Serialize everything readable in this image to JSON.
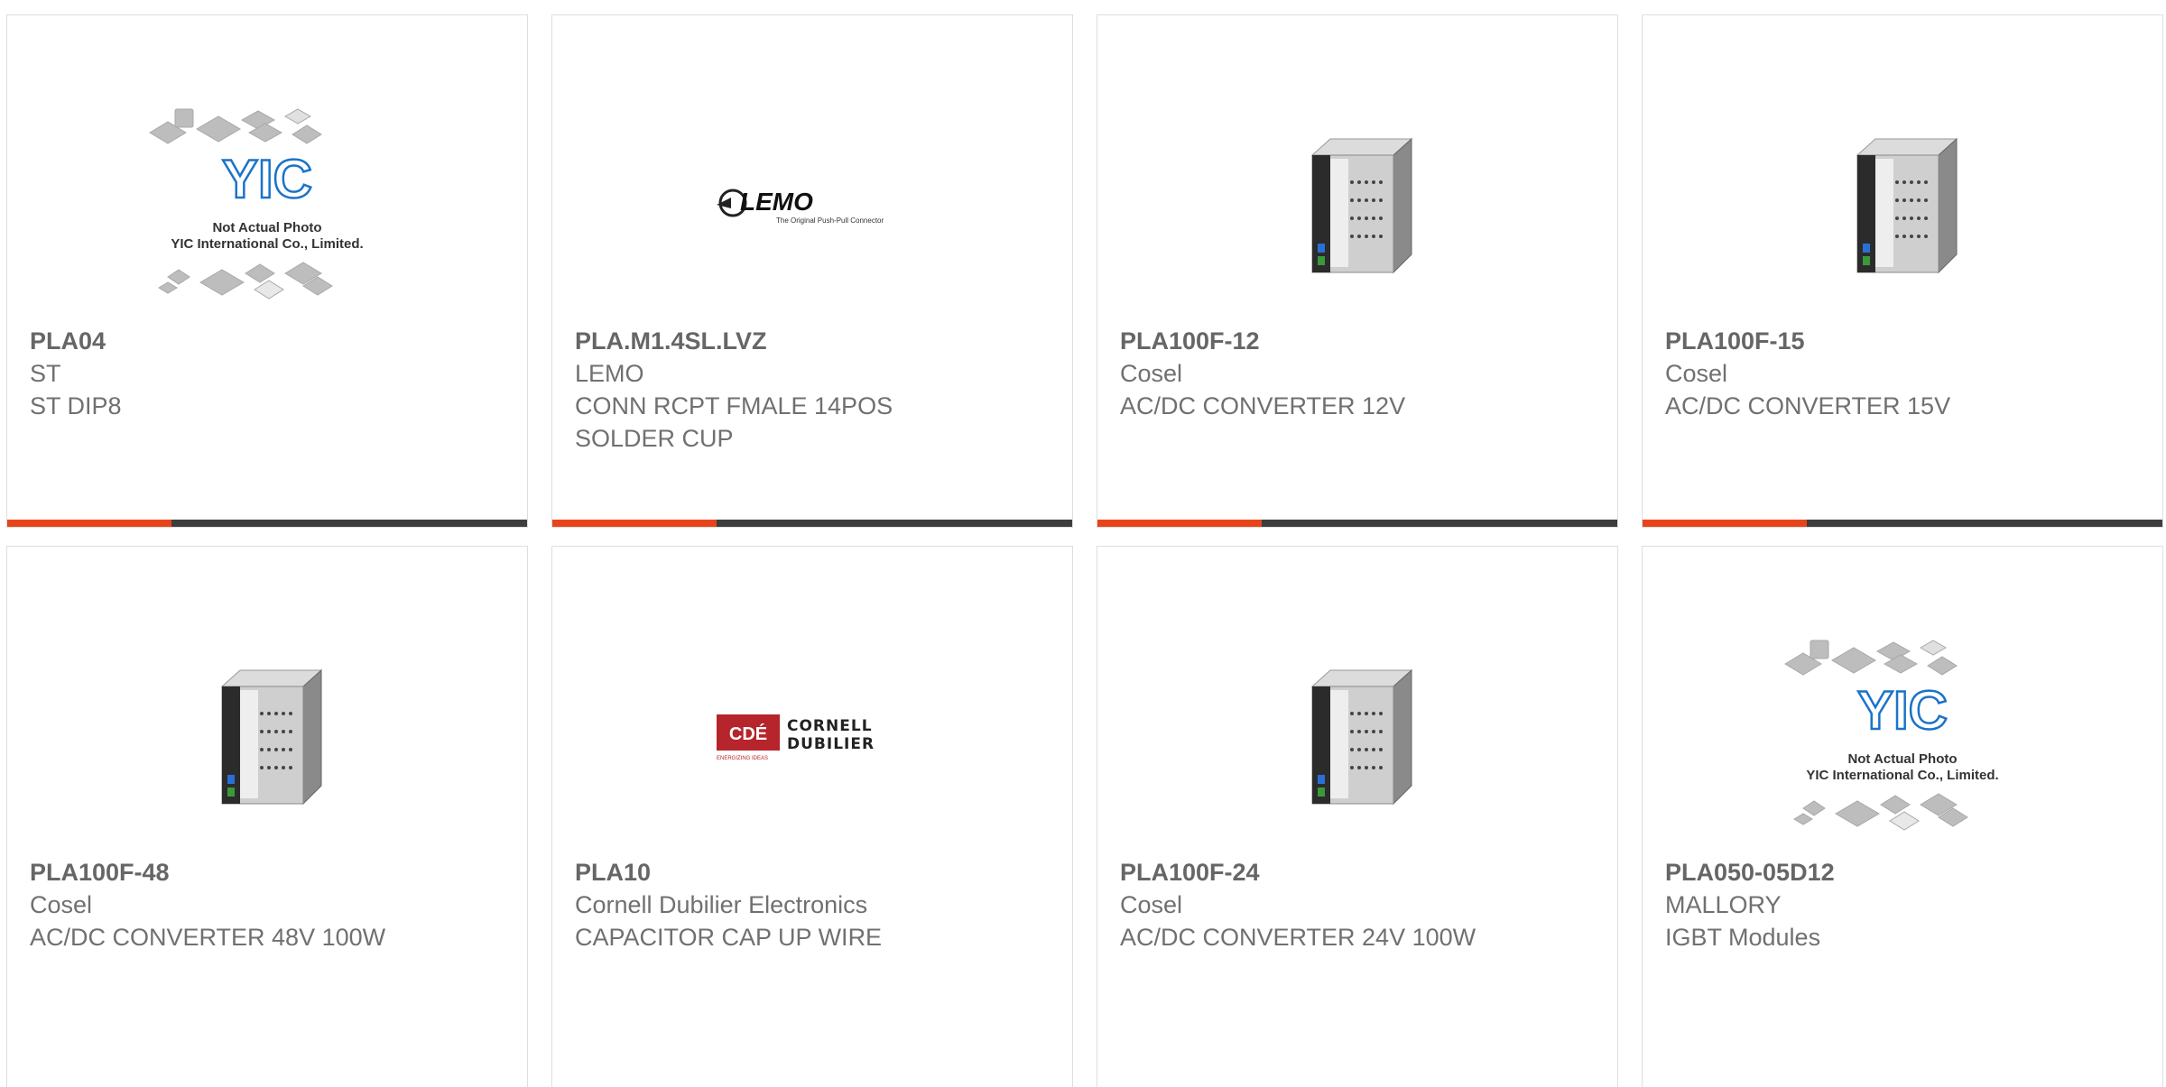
{
  "colors": {
    "accent": "#e8441b",
    "bar_dark": "#3d3d3d",
    "border": "#dedede",
    "text": "#666666"
  },
  "products": [
    {
      "part": "PLA04",
      "manufacturer": "ST",
      "description": "ST DIP8",
      "image": "not-actual-photo",
      "placeholder_line1": "Not Actual Photo",
      "placeholder_line2": "YIC International Co., Limited.",
      "logo_text": "YIC"
    },
    {
      "part": "PLA.M1.4SL.LVZ",
      "manufacturer": "LEMO",
      "description": "CONN RCPT FMALE 14POS SOLDER CUP",
      "image": "lemo-logo",
      "logo_text": "LEMO",
      "logo_sub": "The Original Push-Pull Connector"
    },
    {
      "part": "PLA100F-12",
      "manufacturer": "Cosel",
      "description": "AC/DC CONVERTER 12V",
      "image": "power-supply"
    },
    {
      "part": "PLA100F-15",
      "manufacturer": "Cosel",
      "description": "AC/DC CONVERTER 15V",
      "image": "power-supply"
    },
    {
      "part": "PLA100F-48",
      "manufacturer": "Cosel",
      "description": "AC/DC CONVERTER 48V 100W",
      "image": "power-supply"
    },
    {
      "part": "PLA10",
      "manufacturer": "Cornell Dubilier Electronics",
      "description": "CAPACITOR CAP UP WIRE",
      "image": "cde-logo",
      "logo_text": "CDÉ",
      "logo_name1": "CORNELL",
      "logo_name2": "DUBILIER",
      "logo_tag": "ENERGIZING IDEAS"
    },
    {
      "part": "PLA100F-24",
      "manufacturer": "Cosel",
      "description": "AC/DC CONVERTER 24V 100W",
      "image": "power-supply"
    },
    {
      "part": "PLA050-05D12",
      "manufacturer": "MALLORY",
      "description": "IGBT Modules",
      "image": "not-actual-photo",
      "placeholder_line1": "Not Actual Photo",
      "placeholder_line2": "YIC International Co., Limited.",
      "logo_text": "YIC"
    }
  ]
}
